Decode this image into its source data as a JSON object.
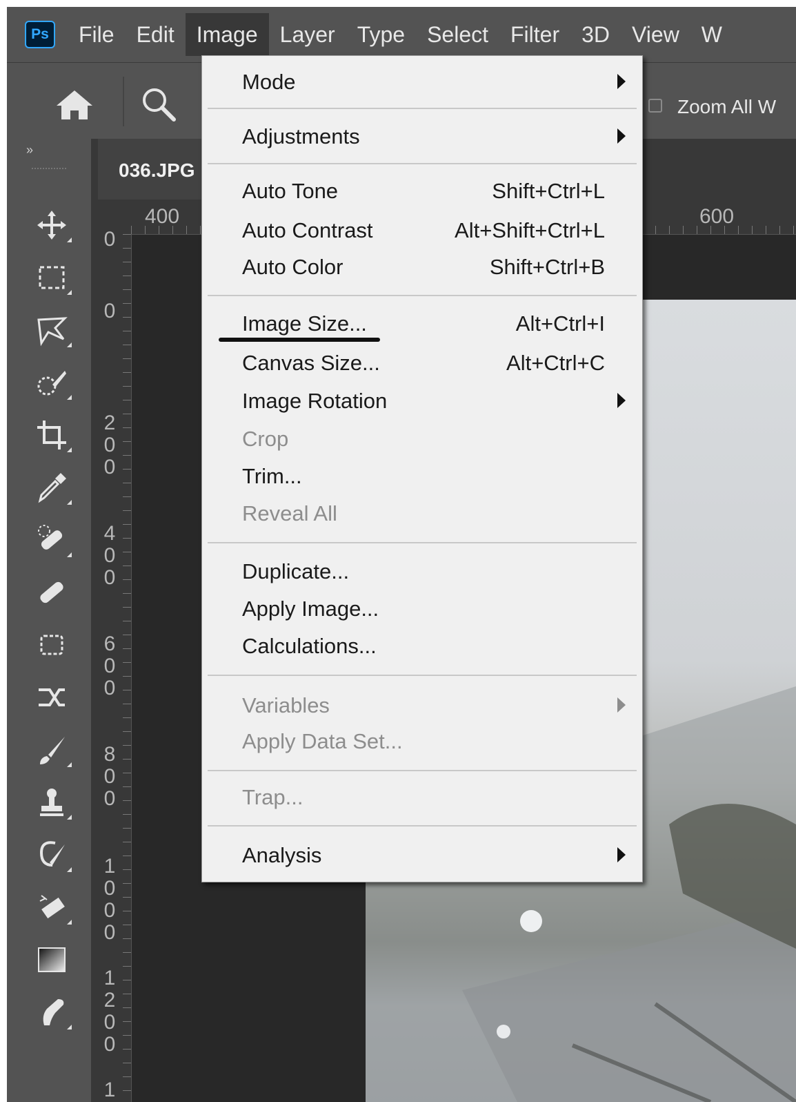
{
  "app": {
    "logo_text": "Ps"
  },
  "menubar": {
    "items": [
      {
        "label": "File"
      },
      {
        "label": "Edit"
      },
      {
        "label": "Image",
        "active": true
      },
      {
        "label": "Layer"
      },
      {
        "label": "Type"
      },
      {
        "label": "Select"
      },
      {
        "label": "Filter"
      },
      {
        "label": "3D"
      },
      {
        "label": "View"
      },
      {
        "label": "W"
      }
    ]
  },
  "options_bar": {
    "zoom_all_label": "Zoom All W",
    "zoom_all_checked": false
  },
  "document": {
    "tab_label": "036.JPG"
  },
  "rulers": {
    "top": [
      "400",
      "600"
    ],
    "left": [
      "0",
      "0",
      "200",
      "400",
      "600",
      "800",
      "1000",
      "1200",
      "1"
    ]
  },
  "toolbar": {
    "collapse_glyph": "»",
    "tools": [
      "move-icon",
      "marquee-icon",
      "lasso-icon",
      "quick-selection-icon",
      "crop-icon",
      "eyedropper-icon",
      "spot-healing-icon",
      "healing-brush-icon",
      "patch-icon",
      "content-aware-move-icon",
      "brush-icon",
      "clone-stamp-icon",
      "history-brush-icon",
      "eraser-icon",
      "gradient-icon",
      "smudge-icon"
    ]
  },
  "image_menu": {
    "items": [
      {
        "label": "Mode",
        "submenu": true
      },
      {
        "label": "Adjustments",
        "submenu": true
      },
      {
        "label": "Auto Tone",
        "shortcut": "Shift+Ctrl+L"
      },
      {
        "label": "Auto Contrast",
        "shortcut": "Alt+Shift+Ctrl+L"
      },
      {
        "label": "Auto Color",
        "shortcut": "Shift+Ctrl+B"
      },
      {
        "label": "Image Size...",
        "shortcut": "Alt+Ctrl+I",
        "highlighted": true
      },
      {
        "label": "Canvas Size...",
        "shortcut": "Alt+Ctrl+C"
      },
      {
        "label": "Image Rotation",
        "submenu": true
      },
      {
        "label": "Crop",
        "disabled": true
      },
      {
        "label": "Trim..."
      },
      {
        "label": "Reveal All",
        "disabled": true
      },
      {
        "label": "Duplicate..."
      },
      {
        "label": "Apply Image..."
      },
      {
        "label": "Calculations..."
      },
      {
        "label": "Variables",
        "submenu": true,
        "disabled": true
      },
      {
        "label": "Apply Data Set...",
        "disabled": true
      },
      {
        "label": "Trap...",
        "disabled": true
      },
      {
        "label": "Analysis",
        "submenu": true
      }
    ]
  },
  "colors": {
    "panel": "#535353",
    "menu_background": "#f0f0f0",
    "disabled_text": "#8d8d8d",
    "ps_blue": "#31a8ff"
  }
}
